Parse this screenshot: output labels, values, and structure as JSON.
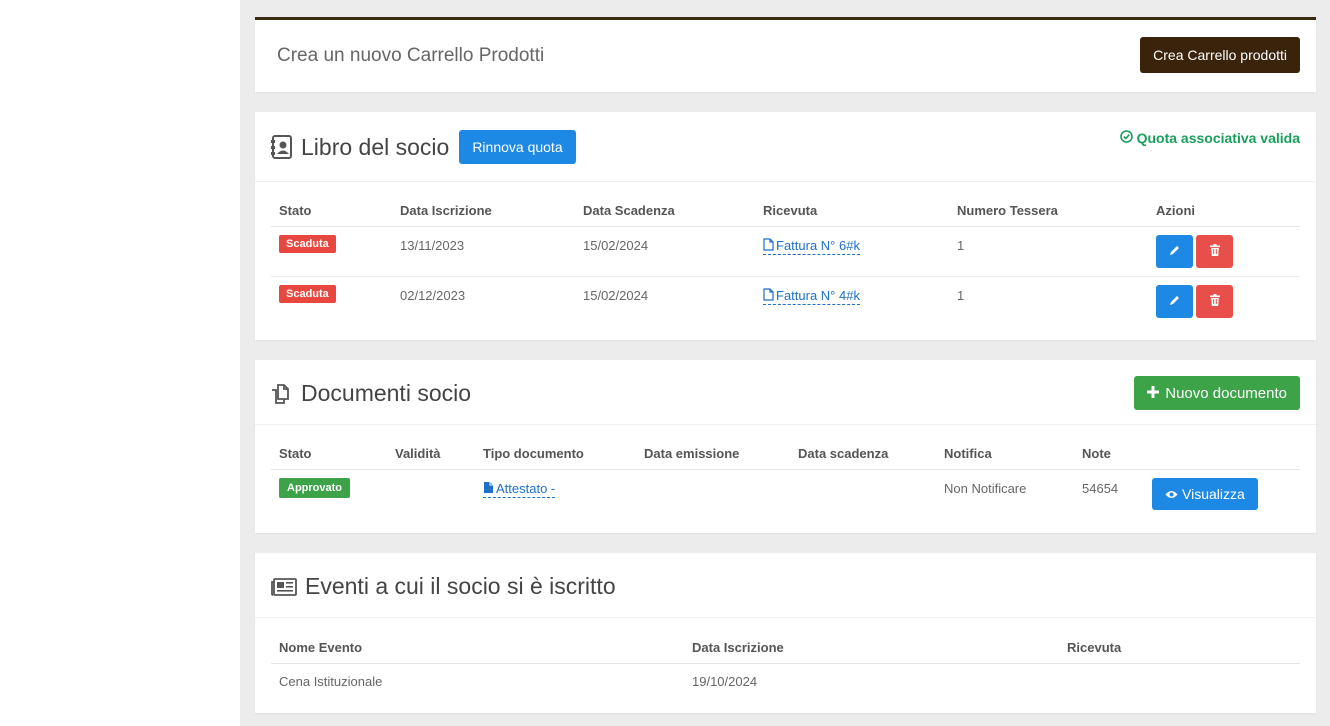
{
  "cart": {
    "label": "Crea un nuovo Carrello Prodotti",
    "button": "Crea Carrello prodotti"
  },
  "libro": {
    "title": "Libro del socio",
    "renew_button": "Rinnova quota",
    "status_text": "Quota associativa valida",
    "columns": [
      "Stato",
      "Data Iscrizione",
      "Data Scadenza",
      "Ricevuta",
      "Numero Tessera",
      "Azioni"
    ],
    "rows": [
      {
        "stato": "Scaduta",
        "iscrizione": "13/11/2023",
        "scadenza": "15/02/2024",
        "ricevuta": "Fattura N° 6#k",
        "tessera": "1"
      },
      {
        "stato": "Scaduta",
        "iscrizione": "02/12/2023",
        "scadenza": "15/02/2024",
        "ricevuta": "Fattura N° 4#k",
        "tessera": "1"
      }
    ]
  },
  "documenti": {
    "title": "Documenti socio",
    "new_button": "Nuovo documento",
    "columns": [
      "Stato",
      "Validità",
      "Tipo documento",
      "Data emissione",
      "Data scadenza",
      "Notifica",
      "Note"
    ],
    "rows": [
      {
        "stato": "Approvato",
        "validita": "",
        "tipo": "Attestato -",
        "emissione": "",
        "scadenza": "",
        "notifica": "Non Notificare",
        "note": "54654",
        "action": "Visualizza"
      }
    ]
  },
  "eventi": {
    "title": "Eventi a cui il socio si è iscritto",
    "columns": [
      "Nome Evento",
      "Data Iscrizione",
      "Ricevuta"
    ],
    "rows": [
      {
        "nome": "Cena Istituzionale",
        "data": "19/10/2024",
        "ricevuta": ""
      }
    ]
  },
  "colors": {
    "accent_dark": "#3a230b",
    "primary": "#1e88e5",
    "success": "#3ca348",
    "danger": "#e8473f",
    "valid_text": "#1a9e5c"
  },
  "icons": {
    "libro": "address-book-icon",
    "valid": "check-circle-icon",
    "documenti": "files-icon",
    "eventi": "newspaper-icon",
    "ricevuta": "file-icon",
    "edit": "pencil-icon",
    "delete": "trash-icon",
    "new_doc": "plus-icon",
    "view": "eye-icon"
  }
}
